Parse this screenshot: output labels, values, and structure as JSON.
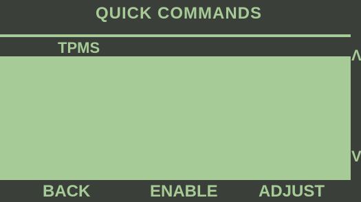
{
  "header": {
    "title": "QUICK COMMANDS"
  },
  "list": {
    "selected_item": "TPMS"
  },
  "scroll": {
    "up_icon": "chevron-up-icon",
    "down_icon": "chevron-down-icon",
    "up_glyph": "Λ",
    "down_glyph": "V"
  },
  "footer": {
    "back_label": "BACK",
    "enable_label": "ENABLE",
    "adjust_label": "ADJUST"
  },
  "colors": {
    "lcd_background": "#a6cb96",
    "lcd_dark": "#3b3f3a"
  }
}
